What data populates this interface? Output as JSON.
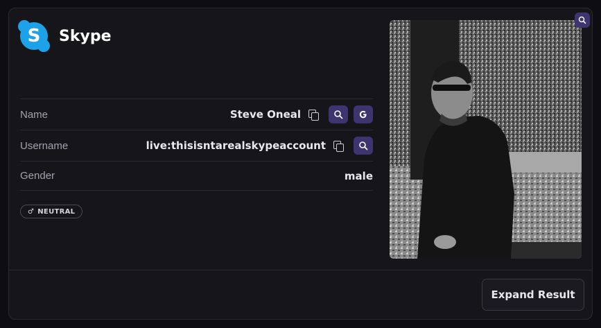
{
  "card": {
    "title": "Skype",
    "logo_icon": "skype-logo-icon",
    "colors": {
      "accent_button": "#3d3470",
      "skype_blue": "#1ba2e8",
      "background": "#15151a"
    }
  },
  "fields": [
    {
      "label": "Name",
      "value": "Steve Oneal"
    },
    {
      "label": "Username",
      "value": "live:thisisntarealskypeaccount"
    },
    {
      "label": "Gender",
      "value": "male"
    }
  ],
  "badge": {
    "symbol": "♂",
    "label": "NEUTRAL"
  },
  "photo": {
    "alt": "Profile photo",
    "zoom_icon": "zoom-search-icon"
  },
  "actions": {
    "expand_label": "Expand Result"
  }
}
